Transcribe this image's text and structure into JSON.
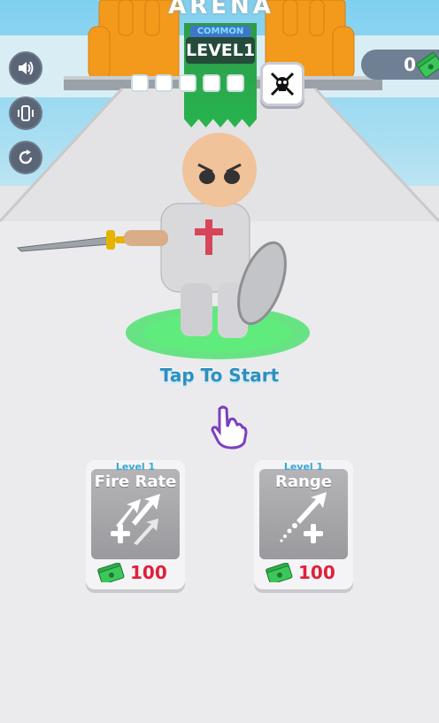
{
  "hud": {
    "arena_title": "ARENA",
    "rarity": "COMMON",
    "level": "LEVEL1",
    "cash_amount": "0",
    "slot_count": 5
  },
  "side_buttons": [
    {
      "name": "sound-icon"
    },
    {
      "name": "vibration-icon"
    },
    {
      "name": "restart-icon"
    }
  ],
  "prompt": {
    "tap_text": "Tap To Start"
  },
  "upgrades": [
    {
      "level": "Level 1",
      "name": "Fire Rate",
      "price": "100"
    },
    {
      "level": "Level 1",
      "name": "Range",
      "price": "100"
    }
  ],
  "colors": {
    "accent_blue": "#2f8fbf",
    "price_red": "#e0203a",
    "cash_green": "#27b44e",
    "button_slate": "#5a6677"
  }
}
